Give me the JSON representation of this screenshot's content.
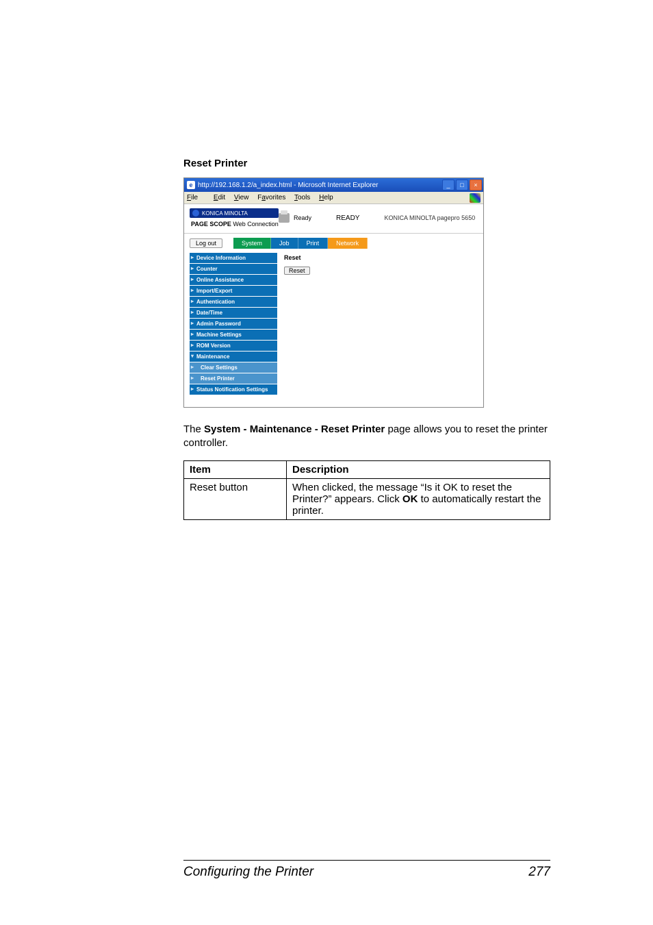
{
  "section_title": "Reset Printer",
  "window": {
    "title": "http://192.168.1.2/a_index.html - Microsoft Internet Explorer",
    "menu": {
      "file": "File",
      "edit": "Edit",
      "view": "View",
      "favorites": "Favorites",
      "tools": "Tools",
      "help": "Help"
    },
    "winbtn": {
      "min": "_",
      "max": "□",
      "close": "×"
    }
  },
  "header": {
    "brand": "KONICA MINOLTA",
    "webconn_prefix": "PAGE SCOPE",
    "webconn": " Web Connection",
    "ready_small": "Ready",
    "ready_big": "READY",
    "device": "KONICA MINOLTA pagepro 5650"
  },
  "logout": "Log out",
  "tabs": {
    "system": "System",
    "job": "Job",
    "print": "Print",
    "network": "Network"
  },
  "sidebar": {
    "items": [
      "Device Information",
      "Counter",
      "Online Assistance",
      "Import/Export",
      "Authentication",
      "Date/Time",
      "Admin Password",
      "Machine Settings",
      "ROM Version",
      "Maintenance",
      "Clear Settings",
      "Reset Printer",
      "Status Notification Settings"
    ]
  },
  "pane": {
    "heading": "Reset",
    "button": "Reset"
  },
  "body": {
    "prefix": "The ",
    "bold": "System - Maintenance - Reset Printer",
    "suffix": " page allows you to reset the printer controller."
  },
  "table": {
    "h1": "Item",
    "h2": "Description",
    "row1_item": "Reset button",
    "row1_desc_a": "When clicked, the message “Is it OK to reset the Printer?” appears. Click ",
    "row1_desc_bold": "OK",
    "row1_desc_b": " to automatically restart the printer."
  },
  "footer": {
    "title": "Configuring the Printer",
    "page": "277"
  }
}
